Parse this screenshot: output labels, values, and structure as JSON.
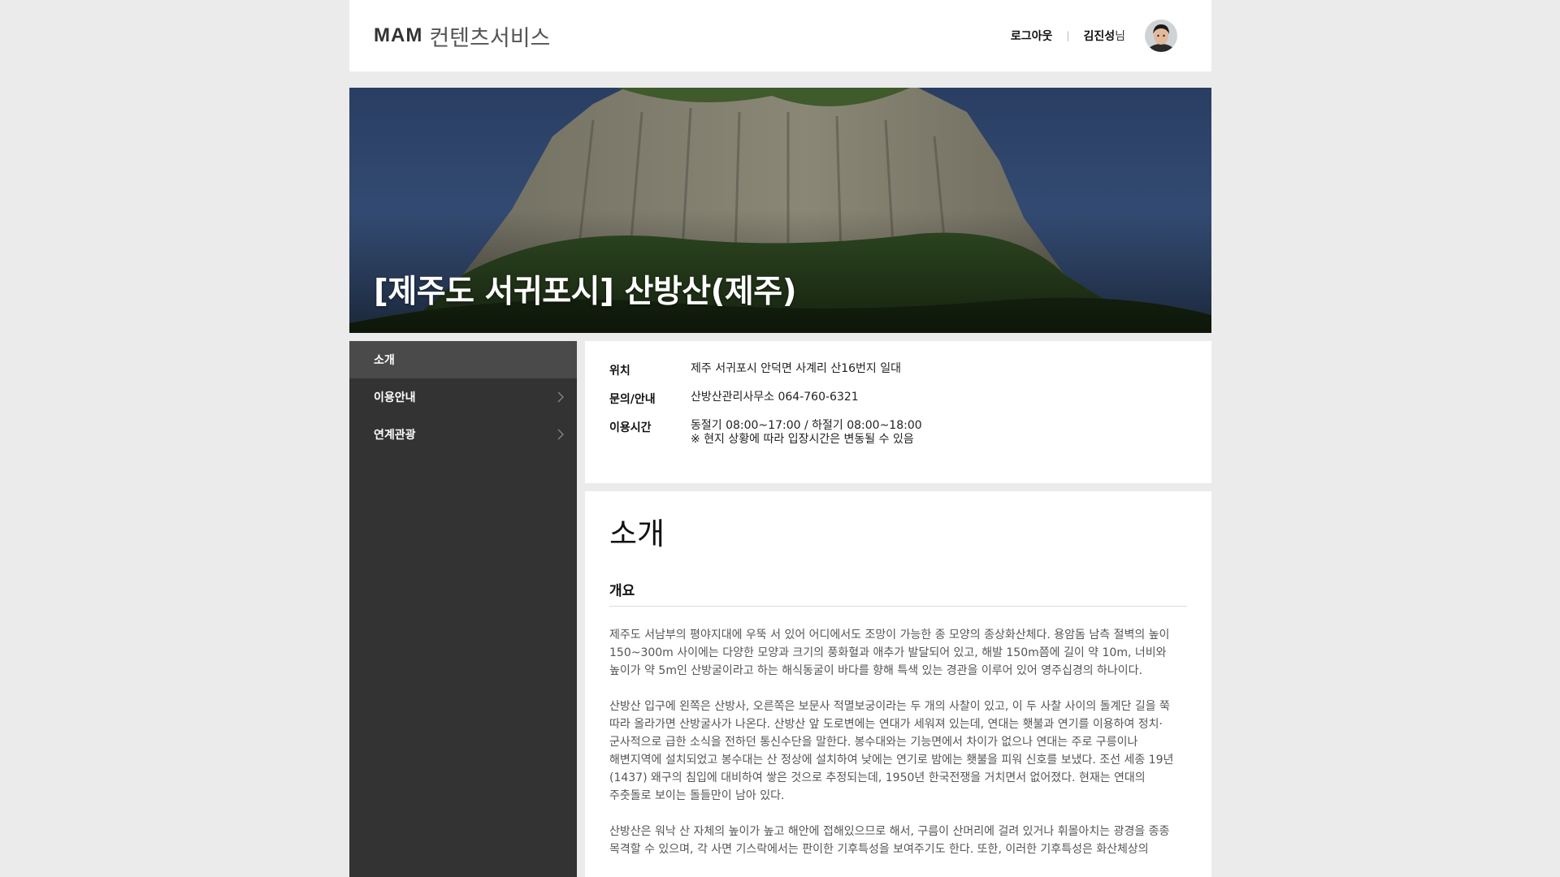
{
  "header": {
    "logo_mam": "MAM",
    "logo_service": "컨텐츠서비스",
    "logout_label": "로그아웃",
    "user_name": "김진성",
    "user_honorific": "님"
  },
  "hero": {
    "title": "[제주도 서귀포시] 산방산(제주)"
  },
  "sidebar": {
    "items": [
      {
        "label": "소개"
      },
      {
        "label": "이용안내"
      },
      {
        "label": "연계관광"
      }
    ]
  },
  "info": {
    "location_label": "위치",
    "location_value": "제주 서귀포시 안덕면 사계리 산16번지 일대",
    "contact_label": "문의/안내",
    "contact_value": "산방산관리사무소 064-760-6321",
    "hours_label": "이용시간",
    "hours_line1": "동절기 08:00~17:00 / 하절기 08:00~18:00",
    "hours_line2": "※ 현지 상황에 따라 입장시간은 변동될 수 있음"
  },
  "content": {
    "heading": "소개",
    "subheading": "개요",
    "paragraphs": [
      "제주도 서남부의 평야지대에 우뚝 서 있어 어디에서도 조망이 가능한 종 모양의 종상화산체다. 용암돔 남측 절벽의 높이 150~300m 사이에는 다양한 모양과 크기의 풍화혈과 애추가 발달되어 있고, 해발 150m쯤에 길이 약 10m, 너비와 높이가 약 5m인 산방굴이라고 하는 해식동굴이 바다를 향해 특색 있는 경관을 이루어 있어 영주십경의 하나이다.",
      "산방산 입구에 왼쪽은 산방사, 오른쪽은 보문사 적멸보궁이라는 두 개의 사찰이 있고, 이 두 사찰 사이의 돌계단 길을 쭉 따라 올라가면 산방굴사가 나온다. 산방산 앞 도로변에는 연대가 세워져 있는데, 연대는 횃불과 연기를 이용하여 정치·군사적으로 급한 소식을 전하던 통신수단을 말한다. 봉수대와는 기능면에서 차이가 없으나 연대는 주로 구릉이나 해변지역에 설치되었고 봉수대는 산 정상에 설치하여 낮에는 연기로 밤에는 횃불을 피워 신호를 보냈다. 조선 세종 19년(1437) 왜구의 침입에 대비하여 쌓은 것으로 추정되는데, 1950년 한국전쟁을 거치면서 없어졌다. 현재는 연대의 주춧돌로 보이는 돌들만이 남아 있다.",
      "산방산은 워낙 산 자체의 높이가 높고 해안에 접해있으므로 해서, 구름이 산머리에 걸려 있거나 휘몰아치는 광경을 종종 목격할 수 있으며, 각 사면 기스락에서는 판이한 기후특성을 보여주기도 한다. 또한, 이러한 기후특성은 화산체상의"
    ]
  }
}
